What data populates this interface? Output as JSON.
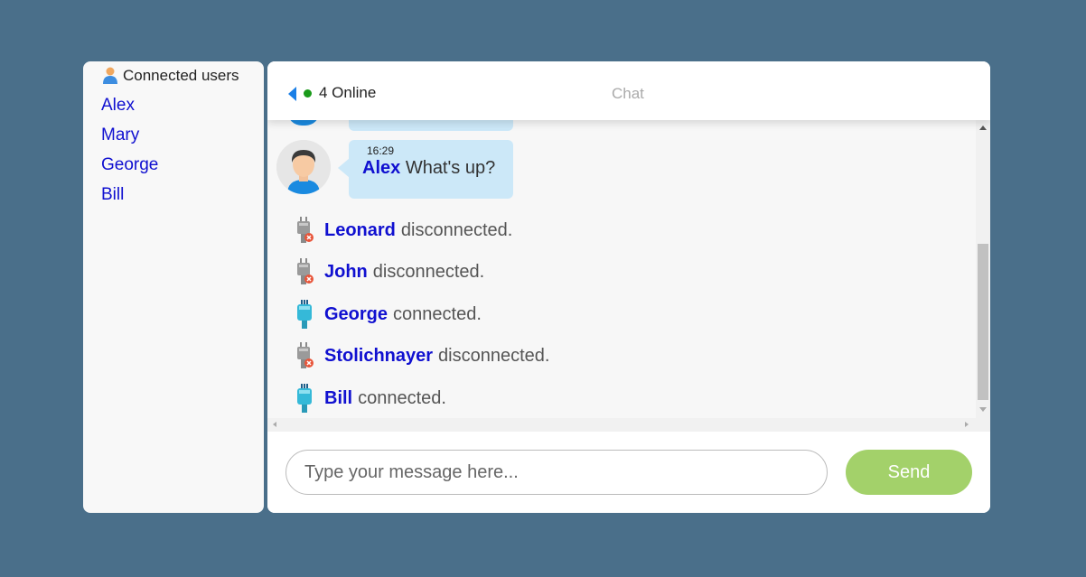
{
  "sidebar": {
    "header": "Connected users",
    "users": [
      "Alex",
      "Mary",
      "George",
      "Bill"
    ]
  },
  "header": {
    "online": "4 Online",
    "title": "Chat"
  },
  "message": {
    "time": "16:29",
    "sender": "Alex",
    "text": "What's up?"
  },
  "events": [
    {
      "user": "Leonard",
      "action": "disconnected.",
      "icon": "plug-disconnected-icon"
    },
    {
      "user": "John",
      "action": "disconnected.",
      "icon": "plug-disconnected-icon"
    },
    {
      "user": "George",
      "action": "connected.",
      "icon": "plug-connected-icon"
    },
    {
      "user": "Stolichnayer",
      "action": "disconnected.",
      "icon": "plug-disconnected-icon"
    },
    {
      "user": "Bill",
      "action": "connected.",
      "icon": "plug-connected-icon"
    }
  ],
  "composer": {
    "placeholder": "Type your message here...",
    "send_label": "Send"
  },
  "colors": {
    "background": "#4a6f8a",
    "username": "#1010d0",
    "bubble": "#cce8f8",
    "send": "#a3d16a",
    "online": "#1a9a1a"
  }
}
